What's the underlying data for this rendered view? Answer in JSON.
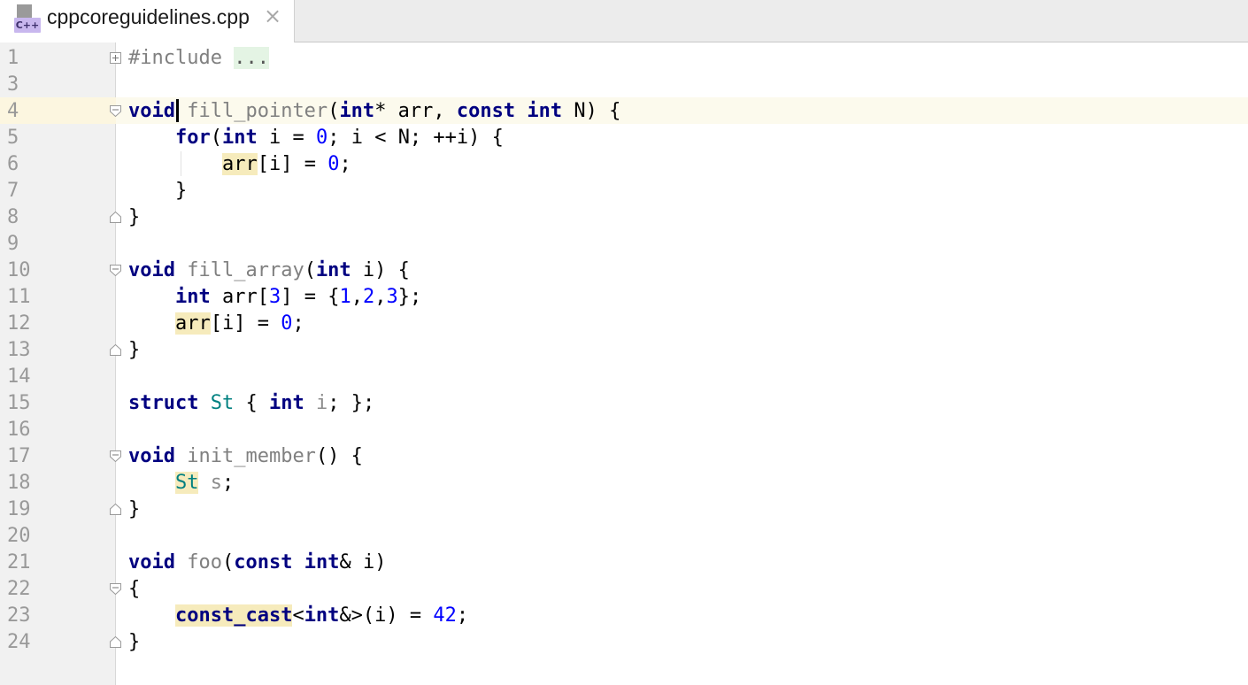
{
  "tab": {
    "title": "cppcoreguidelines.cpp",
    "icon_badge": "C++",
    "close_glyph": "×"
  },
  "lines": [
    {
      "n": "1",
      "fold": "plus"
    },
    {
      "n": "3"
    },
    {
      "n": "4",
      "fold": "open"
    },
    {
      "n": "5"
    },
    {
      "n": "6"
    },
    {
      "n": "7"
    },
    {
      "n": "8",
      "fold": "end"
    },
    {
      "n": "9"
    },
    {
      "n": "10",
      "fold": "open"
    },
    {
      "n": "11"
    },
    {
      "n": "12"
    },
    {
      "n": "13",
      "fold": "end"
    },
    {
      "n": "14"
    },
    {
      "n": "15"
    },
    {
      "n": "16"
    },
    {
      "n": "17",
      "fold": "open"
    },
    {
      "n": "18"
    },
    {
      "n": "19",
      "fold": "end"
    },
    {
      "n": "20"
    },
    {
      "n": "21"
    },
    {
      "n": "22",
      "fold": "open"
    },
    {
      "n": "23"
    },
    {
      "n": "24",
      "fold": "end"
    }
  ],
  "code": {
    "l1": {
      "kw": "#include",
      "folded": "..."
    },
    "l4": {
      "void": "void",
      "name": "fill_pointer",
      "int1": "int",
      "ptr": "* arr, ",
      "const": "const",
      "int2": "int",
      "rest": " N) {"
    },
    "l5": {
      "for": "for",
      "open": "(",
      "int": "int",
      "mid": " i = ",
      "zero": "0",
      "rest": "; i < N; ++i) {"
    },
    "l6": {
      "arr": "arr",
      "mid": "[i] = ",
      "zero": "0",
      "end": ";"
    },
    "l7": {
      "text": "}"
    },
    "l8": {
      "text": "}"
    },
    "l10": {
      "void": "void",
      "name": "fill_array",
      "open": "(",
      "int": "int",
      "rest": " i) {"
    },
    "l11": {
      "int": "int",
      "a": " arr[",
      "n3": "3",
      "b": "] = {",
      "v1": "1",
      "c1": ",",
      "v2": "2",
      "c2": ",",
      "v3": "3",
      "end": "};"
    },
    "l12": {
      "arr": "arr",
      "mid": "[i] = ",
      "zero": "0",
      "end": ";"
    },
    "l13": {
      "text": "}"
    },
    "l15": {
      "struct": "struct",
      "sp": " ",
      "st": "St",
      "a": " { ",
      "int": "int",
      "sp2": " ",
      "i": "i",
      "end": "; };"
    },
    "l17": {
      "void": "void",
      "name": "init_member",
      "rest": "() {"
    },
    "l18": {
      "st": "St",
      "sp": " ",
      "s": "s",
      "end": ";"
    },
    "l19": {
      "text": "}"
    },
    "l21": {
      "void": "void",
      "name": "foo",
      "open": "(",
      "const": "const",
      "sp": " ",
      "int": "int",
      "rest": "& i)"
    },
    "l22": {
      "text": "{"
    },
    "l23": {
      "cc": "const_cast",
      "lt": "<",
      "int": "int",
      "mid": "&>(i) = ",
      "num": "42",
      "end": ";"
    },
    "l24": {
      "text": "}"
    }
  }
}
